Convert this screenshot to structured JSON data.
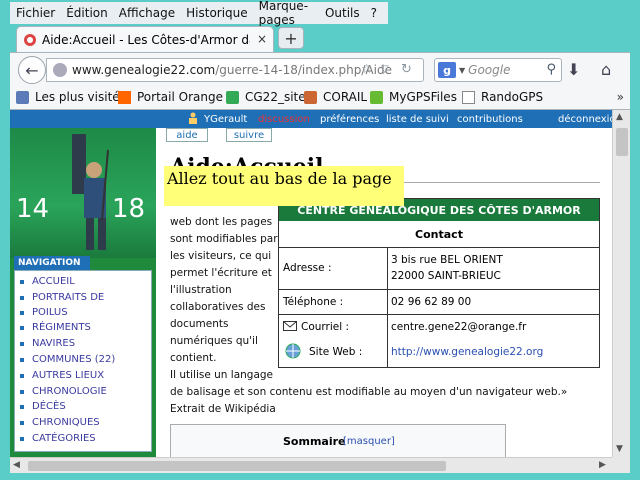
{
  "menu": [
    "Fichier",
    "Édition",
    "Affichage",
    "Historique",
    "Marque-pages",
    "Outils",
    "?"
  ],
  "tab": {
    "title": "Aide:Accueil - Les Côtes-d'Armor dans l...",
    "close": "×",
    "new": "+"
  },
  "url": {
    "host": "www.genealogie22.com",
    "path": "/guerre-14-18/index.php/Aide"
  },
  "search": {
    "engine": "g",
    "placeholder": "Google"
  },
  "bookmarks": [
    "Les plus visités",
    "Portail Orange",
    "CG22_site",
    "CORAIL",
    "MyGPSFiles",
    "RandoGPS"
  ],
  "bookmarks_more": "»",
  "personal": {
    "user": "YGerault",
    "talk": "discussion",
    "prefs": "préférences",
    "watch": "liste de suivi",
    "contrib": "contributions",
    "logout": "déconnexion"
  },
  "pagetabs": {
    "aide": "aide",
    "suivre": "suivre"
  },
  "logo": {
    "left": "14",
    "right": "18"
  },
  "nav": {
    "title": "NAVIGATION",
    "items": [
      "ACCUEIL",
      "PORTRAITS DE",
      "POILUS",
      "RÉGIMENTS",
      "NAVIRES",
      "COMMUNES (22)",
      "AUTRES LIEUX",
      "CHRONOLOGIE",
      "DÉCÈS",
      "CHRONIQUES",
      "CATÉGORIES"
    ]
  },
  "page": {
    "title": "Aide:Accueil",
    "tooltip": "Allez tout au bas de la page",
    "lines": [
      "web dont les pages",
      "sont modifiables par",
      "les visiteurs, ce qui",
      "permet l'écriture et",
      "l'illustration",
      "collaboratives des",
      "documents",
      "numériques qu'il",
      "contient.",
      "Il utilise un langage",
      "de balisage et son contenu est modifiable au moyen d'un navigateur web.»",
      "Extrait de Wikipédia"
    ]
  },
  "infobox": {
    "head": "CENTRE GÉNÉALOGIQUE DES CÔTES D'ARMOR",
    "contact": "Contact",
    "adresse_k": "Adresse :",
    "adresse_v1": "3 bis rue BEL ORIENT",
    "adresse_v2": "22000 SAINT-BRIEUC",
    "tel_k": "Téléphone :",
    "tel_v": "02 96 62 89 00",
    "mail_k": "Courriel :",
    "mail_v": "centre.gene22@orange.fr",
    "web_k": "Site Web :",
    "web_v": "http://www.genealogie22.org"
  },
  "toc": {
    "title": "Sommaire",
    "toggle": "[masquer]"
  }
}
